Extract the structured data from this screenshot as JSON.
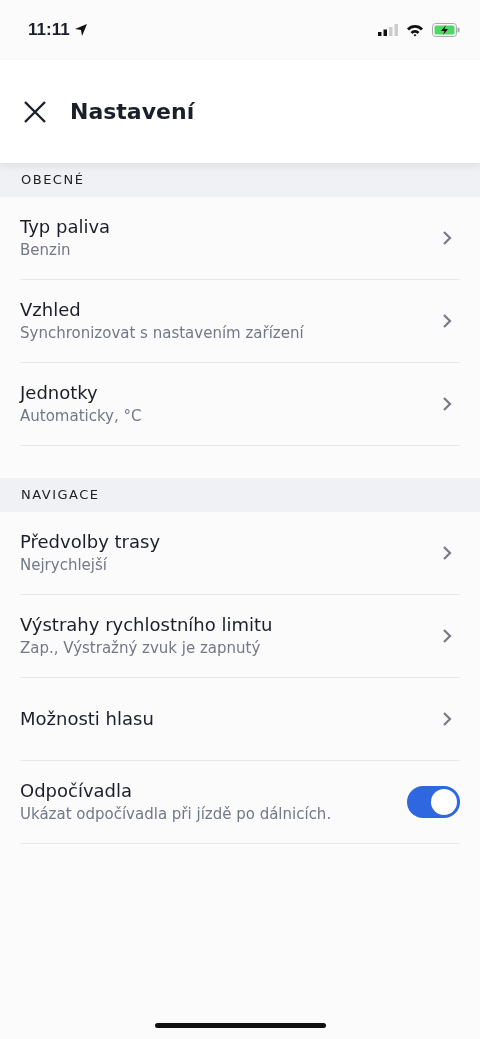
{
  "status_bar": {
    "time": "11:11"
  },
  "header": {
    "title": "Nastavení"
  },
  "sections": [
    {
      "title": "OBECNÉ",
      "items": [
        {
          "kind": "link",
          "label": "Typ paliva",
          "value": "Benzin"
        },
        {
          "kind": "link",
          "label": "Vzhled",
          "value": "Synchronizovat s nastavením zařízení"
        },
        {
          "kind": "link",
          "label": "Jednotky",
          "value": "Automaticky, °C"
        }
      ]
    },
    {
      "title": "NAVIGACE",
      "items": [
        {
          "kind": "link",
          "label": "Předvolby trasy",
          "value": "Nejrychlejší"
        },
        {
          "kind": "link",
          "label": "Výstrahy rychlostního limitu",
          "value": "Zap., Výstražný zvuk je zapnutý"
        },
        {
          "kind": "link",
          "label": "Možnosti hlasu"
        },
        {
          "kind": "toggle",
          "label": "Odpočívadla",
          "value": "Ukázat odpočívadla při jízdě po dálnicích.",
          "on": true
        }
      ]
    }
  ]
}
